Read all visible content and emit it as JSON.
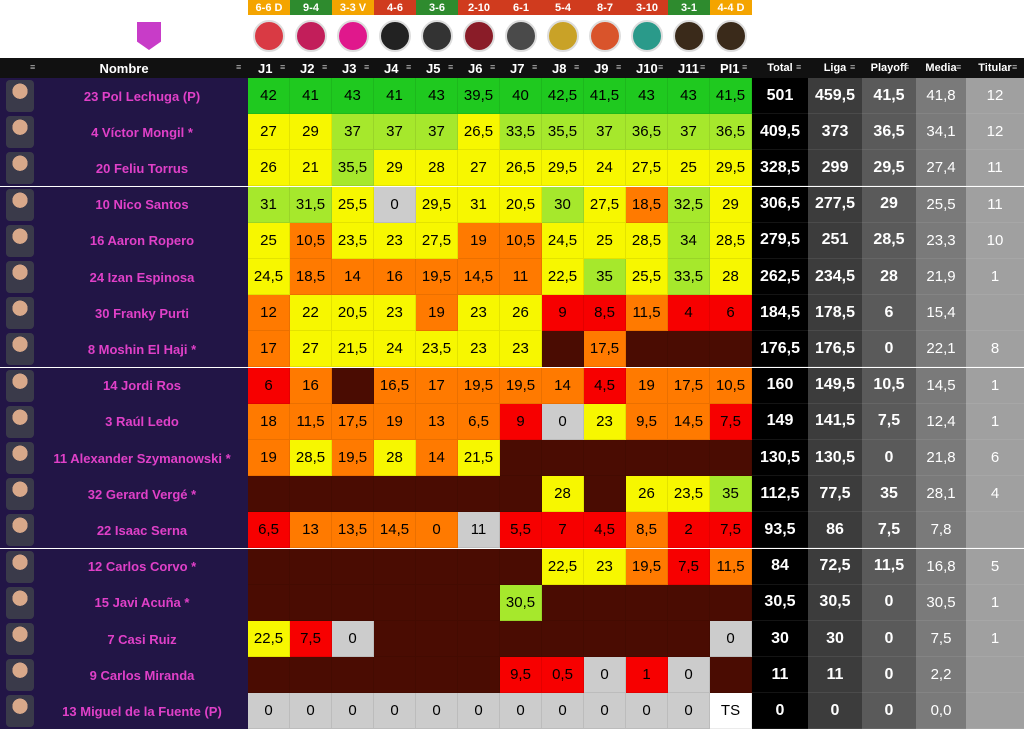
{
  "header": {
    "name_col": "Nombre",
    "matchdays": [
      {
        "label": "J1",
        "result": "6-6 D",
        "res_color": "#f4a400",
        "badge_color": "#d93a44",
        "badge_icon": "dumbbell-shield-icon"
      },
      {
        "label": "J2",
        "result": "9-4",
        "res_color": "#2e8b2e",
        "badge_color": "#c21e5a",
        "badge_icon": "saiyans-crest-icon"
      },
      {
        "label": "J3",
        "result": "3-3 V",
        "res_color": "#f4a400",
        "badge_color": "#e0188c",
        "badge_icon": "kings-k-icon"
      },
      {
        "label": "J4",
        "result": "4-6",
        "res_color": "#d03b1e",
        "badge_color": "#222222",
        "badge_icon": "xbuyer-logo-icon"
      },
      {
        "label": "J5",
        "result": "3-6",
        "res_color": "#2e8b2e",
        "badge_color": "#333333",
        "badge_icon": "pio-logo-icon"
      },
      {
        "label": "J6",
        "result": "2-10",
        "res_color": "#d03b1e",
        "badge_color": "#8a1c28",
        "badge_icon": "ultimate-badge-icon"
      },
      {
        "label": "J7",
        "result": "6-1",
        "res_color": "#d03b1e",
        "badge_color": "#4a4a4a",
        "badge_icon": "tree-crest-icon"
      },
      {
        "label": "J8",
        "result": "5-4",
        "res_color": "#d03b1e",
        "badge_color": "#c9a227",
        "badge_icon": "lightning-crest-icon"
      },
      {
        "label": "J9",
        "result": "8-7",
        "res_color": "#d03b1e",
        "badge_color": "#d9542b",
        "badge_icon": "flame-crest-icon"
      },
      {
        "label": "J10",
        "result": "3-10",
        "res_color": "#d03b1e",
        "badge_color": "#2a9a8a",
        "badge_icon": "peace-crest-icon"
      },
      {
        "label": "J11",
        "result": "3-1",
        "res_color": "#2e8b2e",
        "badge_color": "#3a2a1a",
        "badge_icon": "lion-crest-icon"
      },
      {
        "label": "PI1",
        "result": "4-4 D",
        "res_color": "#f4a400",
        "badge_color": "#3a2a1a",
        "badge_icon": "lion-crest-icon"
      }
    ],
    "summary_cols": [
      "Total",
      "Liga",
      "Playoff",
      "Media",
      "Titular"
    ]
  },
  "team_crest_color": "#c83cc8",
  "colors": {
    "g": "#1fc91f",
    "l": "#a6e82c",
    "y": "#f7f700",
    "o": "#ff7a00",
    "r": "#f70000",
    "w": "#cccccc",
    "t": "#ffffff",
    "b": "#4a0c02"
  },
  "players": [
    {
      "name": "23 Pol Lechuga (P)",
      "scores": [
        "42",
        "41",
        "43",
        "41",
        "43",
        "39,5",
        "40",
        "42,5",
        "41,5",
        "43",
        "43",
        "41,5"
      ],
      "colors": "gggggggggggg",
      "total": "501",
      "liga": "459,5",
      "playoff": "41,5",
      "media": "41,8",
      "titular": "12"
    },
    {
      "name": "4 Víctor Mongil *",
      "scores": [
        "27",
        "29",
        "37",
        "37",
        "37",
        "26,5",
        "33,5",
        "35,5",
        "37",
        "36,5",
        "37",
        "36,5"
      ],
      "colors": "yylllylllllll",
      "total": "409,5",
      "liga": "373",
      "playoff": "36,5",
      "media": "34,1",
      "titular": "12"
    },
    {
      "name": "20 Feliu Torrus",
      "scores": [
        "26",
        "21",
        "35,5",
        "29",
        "28",
        "27",
        "26,5",
        "29,5",
        "24",
        "27,5",
        "25",
        "29,5"
      ],
      "colors": "yylyyyyyyyyy",
      "total": "328,5",
      "liga": "299",
      "playoff": "29,5",
      "media": "27,4",
      "titular": "11"
    },
    {
      "name": "10 Nico Santos",
      "scores": [
        "31",
        "31,5",
        "25,5",
        "0",
        "29,5",
        "31",
        "20,5",
        "30",
        "27,5",
        "18,5",
        "32,5",
        "29"
      ],
      "colors": "llywyyylyoly",
      "total": "306,5",
      "liga": "277,5",
      "playoff": "29",
      "media": "25,5",
      "titular": "11"
    },
    {
      "name": "16 Aaron Ropero",
      "scores": [
        "25",
        "10,5",
        "23,5",
        "23",
        "27,5",
        "19",
        "10,5",
        "24,5",
        "25",
        "28,5",
        "34",
        "28,5"
      ],
      "colors": "yoyyyooyyyly",
      "total": "279,5",
      "liga": "251",
      "playoff": "28,5",
      "media": "23,3",
      "titular": "10"
    },
    {
      "name": "24 Izan Espinosa",
      "scores": [
        "24,5",
        "18,5",
        "14",
        "16",
        "19,5",
        "14,5",
        "11",
        "22,5",
        "35",
        "25,5",
        "33,5",
        "28"
      ],
      "colors": "yooooooylyly",
      "total": "262,5",
      "liga": "234,5",
      "playoff": "28",
      "media": "21,9",
      "titular": "1"
    },
    {
      "name": "30 Franky Purti",
      "scores": [
        "12",
        "22",
        "20,5",
        "23",
        "19",
        "23",
        "26",
        "9",
        "8,5",
        "11,5",
        "4",
        "6"
      ],
      "colors": "oyyyoyyrrorr",
      "total": "184,5",
      "liga": "178,5",
      "playoff": "6",
      "media": "15,4",
      "titular": ""
    },
    {
      "name": "8 Moshin El Haji *",
      "scores": [
        "17",
        "27",
        "21,5",
        "24",
        "23,5",
        "23",
        "23",
        "",
        "17,5",
        "",
        "",
        ""
      ],
      "colors": "oyyyyyybobbb",
      "total": "176,5",
      "liga": "176,5",
      "playoff": "0",
      "media": "22,1",
      "titular": "8"
    },
    {
      "name": "14 Jordi Ros",
      "scores": [
        "6",
        "16",
        "",
        "16,5",
        "17",
        "19,5",
        "19,5",
        "14",
        "4,5",
        "19",
        "17,5",
        "10,5"
      ],
      "colors": "robooooorooo",
      "total": "160",
      "liga": "149,5",
      "playoff": "10,5",
      "media": "14,5",
      "titular": "1"
    },
    {
      "name": "3 Raúl Ledo",
      "scores": [
        "18",
        "11,5",
        "17,5",
        "19",
        "13",
        "6,5",
        "9",
        "0",
        "23",
        "9,5",
        "14,5",
        "7,5"
      ],
      "colors": "oooooorwyoor",
      "total": "149",
      "liga": "141,5",
      "playoff": "7,5",
      "media": "12,4",
      "titular": "1"
    },
    {
      "name": "11 Alexander Szymanowski *",
      "scores": [
        "19",
        "28,5",
        "19,5",
        "28",
        "14",
        "21,5",
        "",
        "",
        "",
        "",
        "",
        ""
      ],
      "colors": "oyoyoybbbbbb",
      "total": "130,5",
      "liga": "130,5",
      "playoff": "0",
      "media": "21,8",
      "titular": "6"
    },
    {
      "name": "32 Gerard Vergé *",
      "scores": [
        "",
        "",
        "",
        "",
        "",
        "",
        "",
        "28",
        "",
        "26",
        "23,5",
        "35"
      ],
      "colors": "bbbbbbbybyyl",
      "total": "112,5",
      "liga": "77,5",
      "playoff": "35",
      "media": "28,1",
      "titular": "4"
    },
    {
      "name": "22 Isaac Serna",
      "scores": [
        "6,5",
        "13",
        "13,5",
        "14,5",
        "0",
        "11",
        "5,5",
        "7",
        "4,5",
        "8,5",
        "2",
        "7,5"
      ],
      "colors": "roooowrrrorr",
      "total": "93,5",
      "liga": "86",
      "playoff": "7,5",
      "media": "7,8",
      "titular": ""
    },
    {
      "name": "12 Carlos Corvo *",
      "scores": [
        "",
        "",
        "",
        "",
        "",
        "",
        "",
        "22,5",
        "23",
        "19,5",
        "7,5",
        "11,5"
      ],
      "colors": "bbbbbbbyyoro",
      "total": "84",
      "liga": "72,5",
      "playoff": "11,5",
      "media": "16,8",
      "titular": "5"
    },
    {
      "name": "15 Javi Acuña *",
      "scores": [
        "",
        "",
        "",
        "",
        "",
        "",
        "30,5",
        "",
        "",
        "",
        "",
        ""
      ],
      "colors": "bbbbbblbbbbb",
      "total": "30,5",
      "liga": "30,5",
      "playoff": "0",
      "media": "30,5",
      "titular": "1"
    },
    {
      "name": "7 Casi Ruiz",
      "scores": [
        "22,5",
        "7,5",
        "0",
        "",
        "",
        "",
        "",
        "",
        "",
        "",
        "",
        "0"
      ],
      "colors": "yrwbbbbbbbbw",
      "total": "30",
      "liga": "30",
      "playoff": "0",
      "media": "7,5",
      "titular": "1"
    },
    {
      "name": "9 Carlos Miranda",
      "scores": [
        "",
        "",
        "",
        "",
        "",
        "",
        "9,5",
        "0,5",
        "0",
        "1",
        "0",
        ""
      ],
      "colors": "bbbbbbrrwrwb",
      "total": "11",
      "liga": "11",
      "playoff": "0",
      "media": "2,2",
      "titular": ""
    },
    {
      "name": "13 Miguel de la Fuente (P)",
      "scores": [
        "0",
        "0",
        "0",
        "0",
        "0",
        "0",
        "0",
        "0",
        "0",
        "0",
        "0",
        "TS"
      ],
      "colors": "wwwwwwwwwwwt",
      "total": "0",
      "liga": "0",
      "playoff": "0",
      "media": "0,0",
      "titular": ""
    }
  ]
}
